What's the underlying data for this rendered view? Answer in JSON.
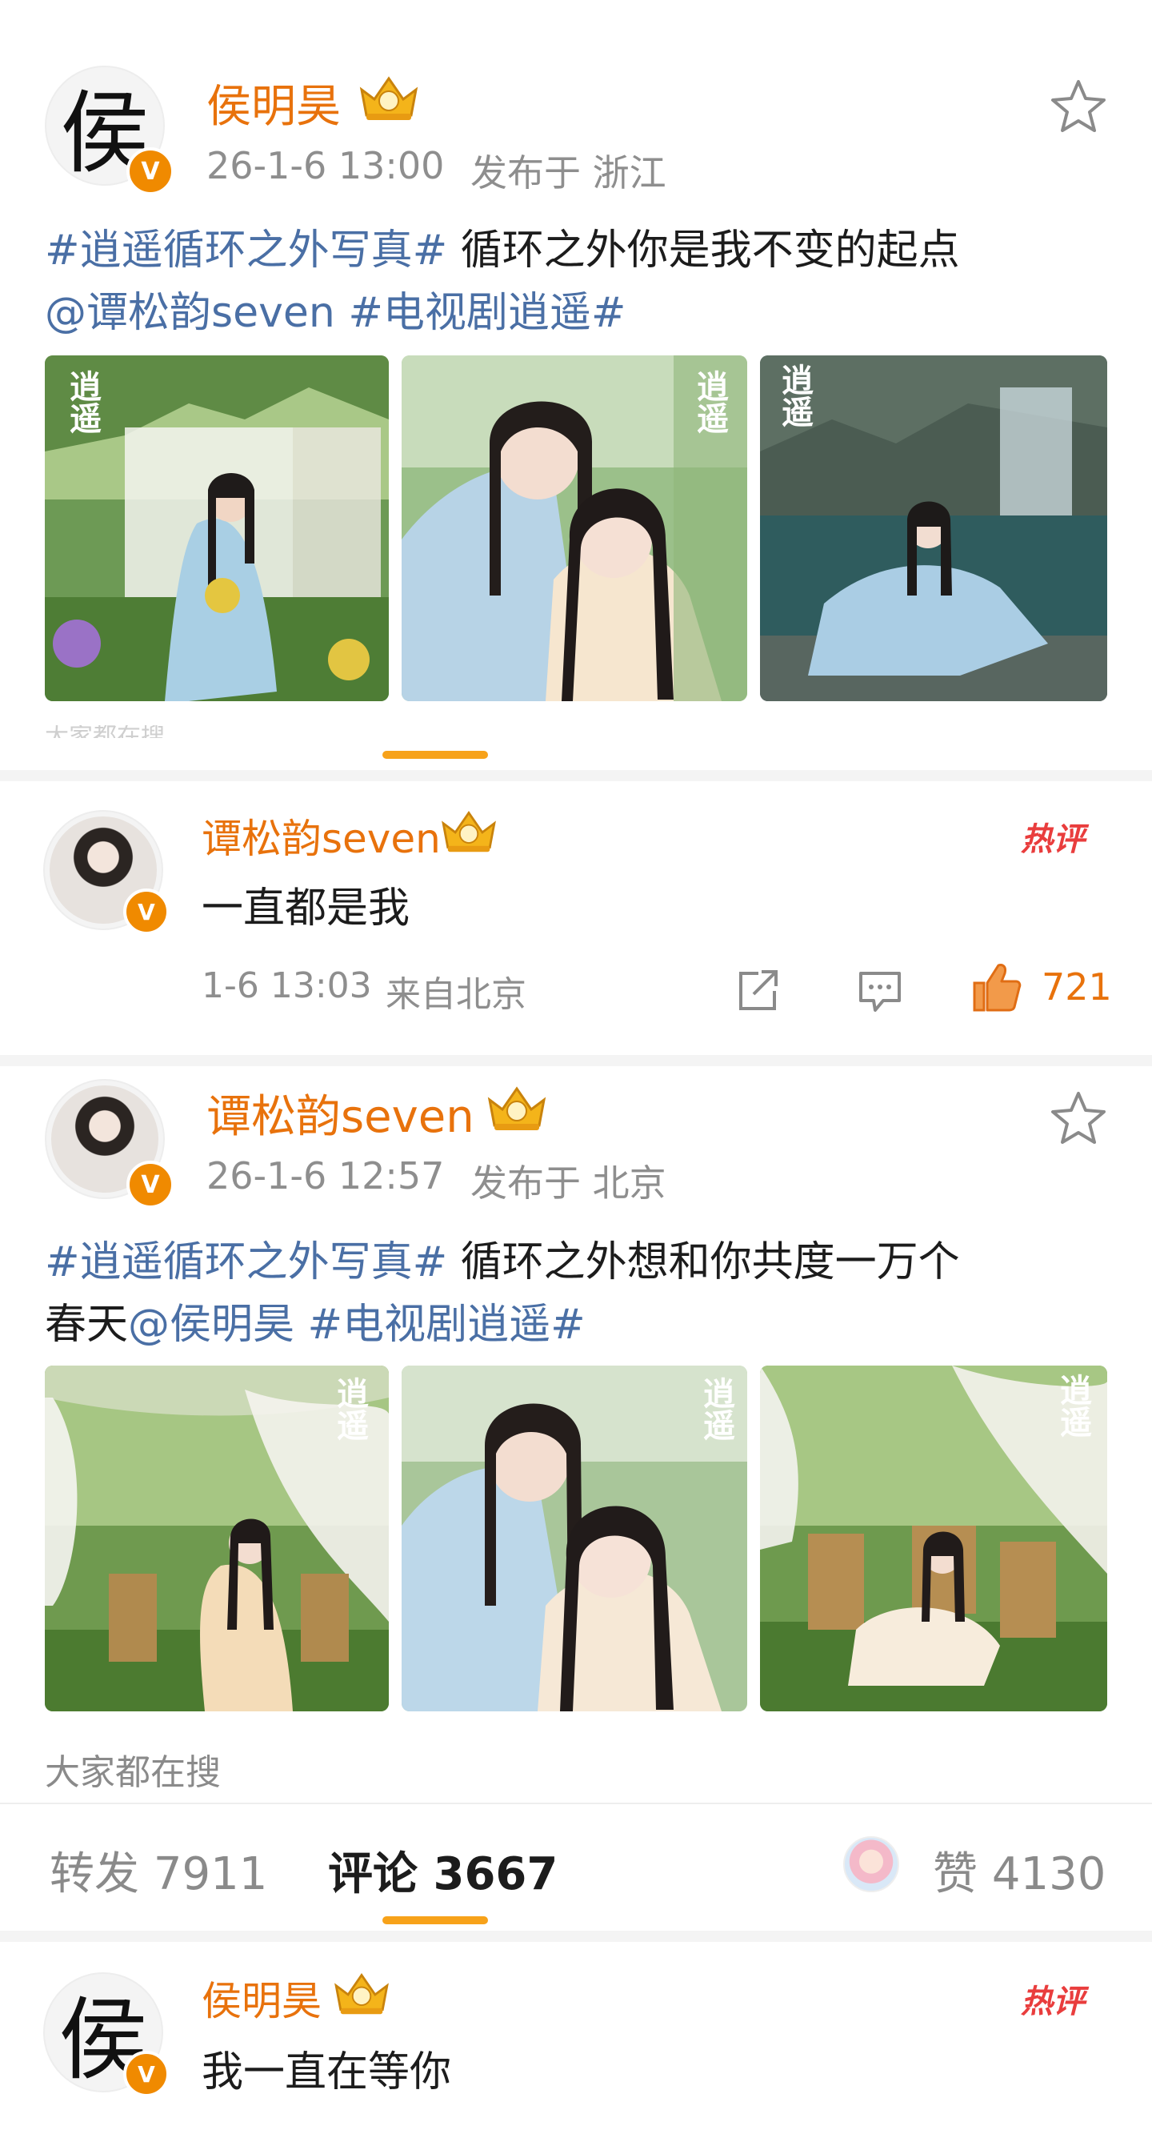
{
  "post1": {
    "avatar_char": "侯",
    "verified_badge": "V",
    "username": "侯明昊",
    "crown_icon": "gold-crown-icon",
    "time": "26-1-6 13:00",
    "location": "发布于 浙江",
    "topic1": "#逍遥循环之外写真#",
    "text1": " 循环之外你是我不变的起点",
    "mention": "@谭松韵seven",
    "topic2": " #电视剧逍遥#",
    "photo_watermark": "逍遥",
    "faded_line": "大家都在搜"
  },
  "comment1": {
    "username": "谭松韵seven",
    "hot_label": "热评",
    "text": "一直都是我",
    "time": "1-6 13:03",
    "location": "来自北京",
    "like_count": "721",
    "icons": [
      "share-icon",
      "comment-icon",
      "like-icon"
    ]
  },
  "post2": {
    "username": "谭松韵seven",
    "time": "26-1-6 12:57",
    "location": "发布于 北京",
    "topic1": "#逍遥循环之外写真#",
    "text1": " 循环之外想和你共度一万个",
    "text2": "春天",
    "mention": "@侯明昊",
    "topic2": " #电视剧逍遥#",
    "photo_watermark": "逍遥",
    "searching_label": "大家都在搜"
  },
  "stats": {
    "repost_label": "转发",
    "repost_count": "7911",
    "comment_label": "评论",
    "comment_count": "3667",
    "like_label": "赞",
    "like_count": "4130"
  },
  "comment2": {
    "avatar_char": "侯",
    "username": "侯明昊",
    "hot_label": "热评",
    "text": "我一直在等你"
  },
  "colors": {
    "username": "#e8720c",
    "topic": "#4a6fa5",
    "hot": "#e93d3d",
    "indicator": "#f7a21a"
  }
}
